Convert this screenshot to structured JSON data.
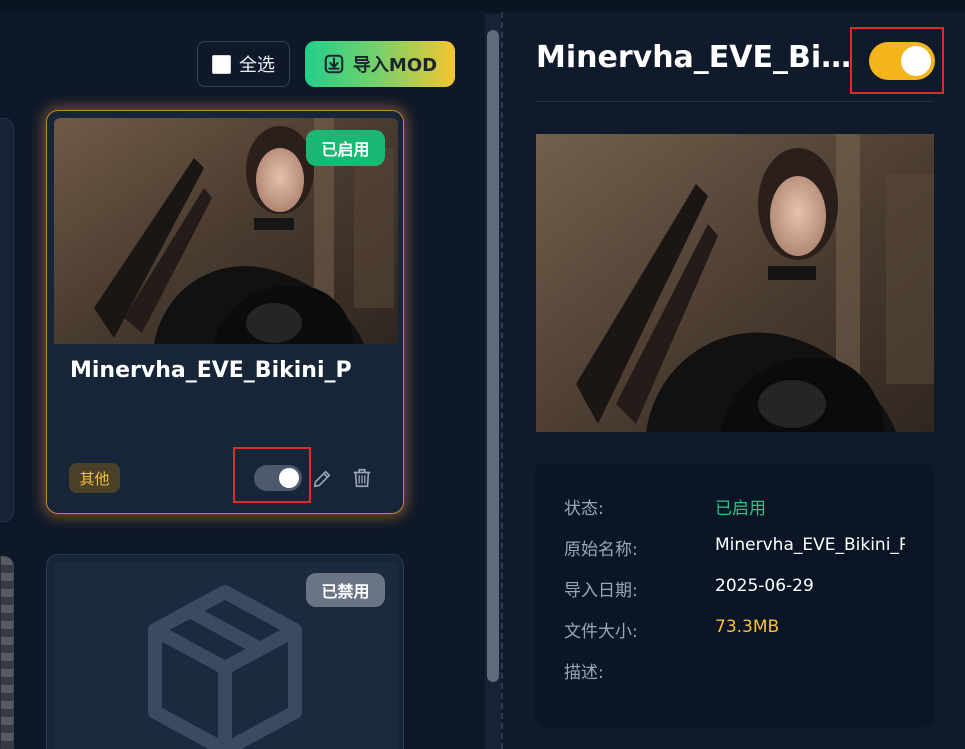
{
  "toolbar": {
    "select_all_label": "全选",
    "import_label": "导入MOD"
  },
  "cards": [
    {
      "title": "Minervha_EVE_Bikini_P",
      "status": "已启用",
      "category": "其他",
      "enabled": true
    },
    {
      "status": "已禁用",
      "enabled": false
    }
  ],
  "detail": {
    "title": "Minervha_EVE_Bikin...",
    "enabled": true,
    "fields": {
      "status_label": "状态:",
      "status_value": "已启用",
      "original_name_label": "原始名称:",
      "original_name_value": "Minervha_EVE_Bikini_P",
      "import_date_label": "导入日期:",
      "import_date_value": "2025-06-29",
      "file_size_label": "文件大小:",
      "file_size_value": "73.3MB",
      "description_label": "描述:"
    }
  },
  "colors": {
    "enabled_green": "#19b874",
    "accent_yellow": "#f4b51c",
    "disabled_gray": "#6b7484",
    "highlight_red": "#e02b2b"
  },
  "icons": [
    "checkbox-icon",
    "import-icon",
    "edit-icon",
    "trash-icon",
    "package-box-icon"
  ]
}
